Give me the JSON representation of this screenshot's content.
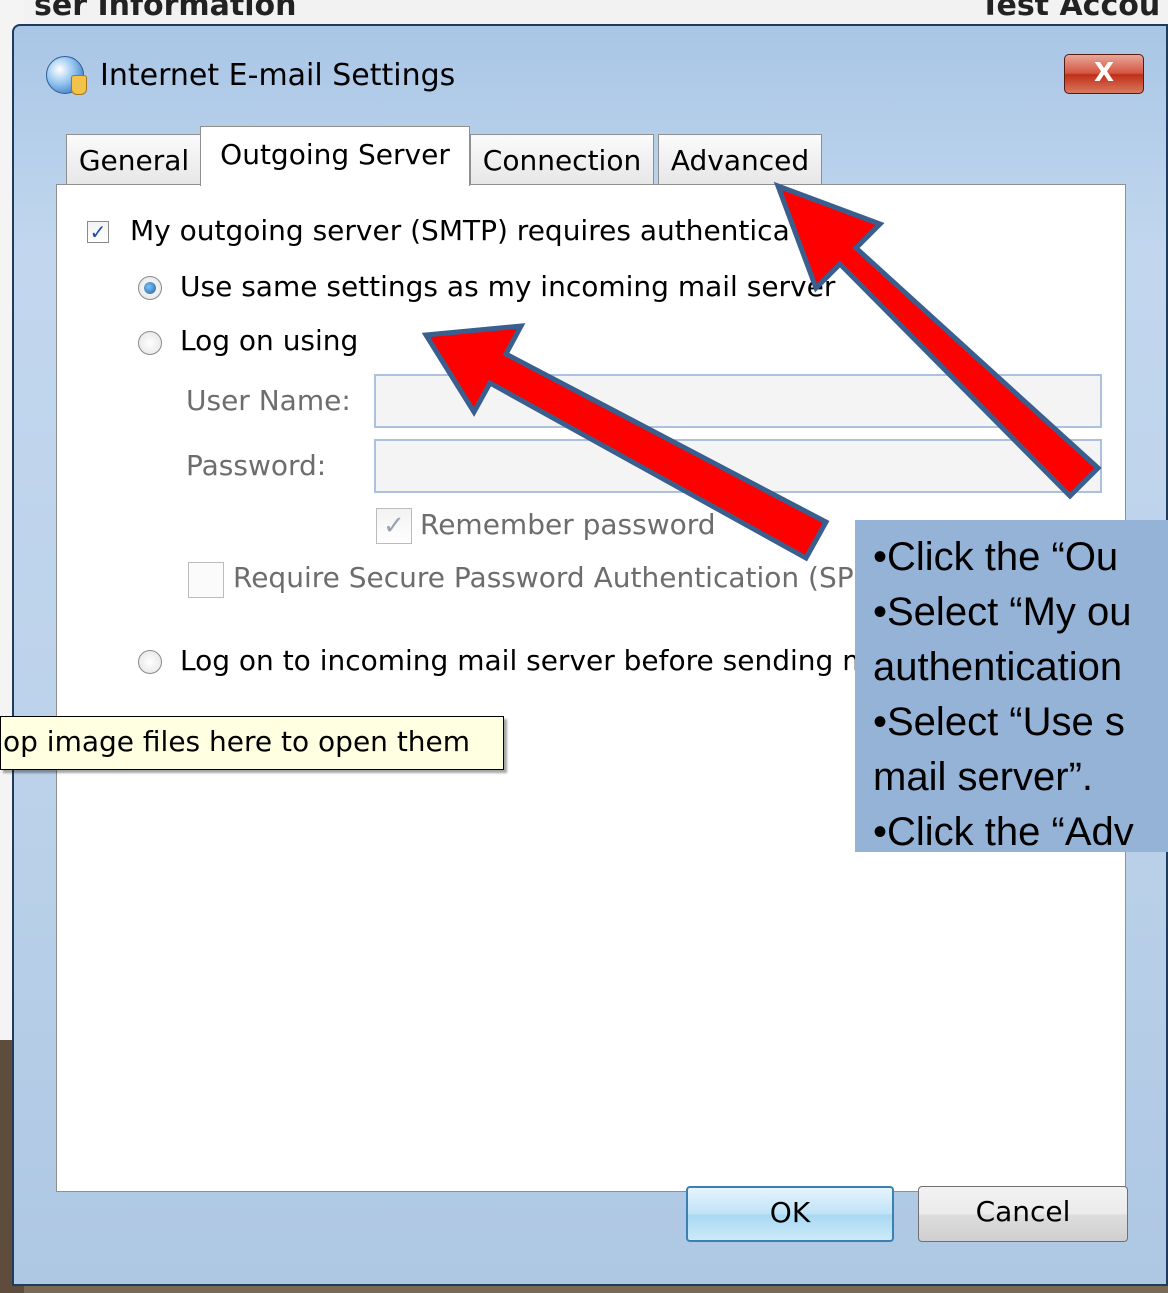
{
  "background": {
    "title_left": "ser Information",
    "title_right": "Test Accou"
  },
  "window": {
    "title": "Internet E-mail Settings",
    "close_label": "X"
  },
  "tabs": [
    {
      "label": "General",
      "active": false
    },
    {
      "label": "Outgoing Server",
      "active": true
    },
    {
      "label": "Connection",
      "active": false
    },
    {
      "label": "Advanced",
      "active": false
    }
  ],
  "outgoing": {
    "smtp_auth_label": "My outgoing server (SMTP) requires authentica",
    "smtp_auth_checked": true,
    "use_same_label": "Use same settings as my incoming mail server",
    "use_same_selected": true,
    "log_on_using_label": "Log on using",
    "log_on_using_selected": false,
    "user_name_label": "User Name:",
    "user_name_value": "",
    "password_label": "Password:",
    "password_value": "",
    "remember_password_label": "Remember password",
    "remember_password_checked": true,
    "spa_label": "Require Secure Password Authentication (SP",
    "spa_checked": false,
    "log_on_incoming_label": "Log on to incoming mail server before sending ma",
    "log_on_incoming_selected": false
  },
  "tooltip": "op image files here to open them",
  "buttons": {
    "ok": "OK",
    "cancel": "Cancel"
  },
  "annotation": {
    "lines": [
      "•Click the “Ou",
      "•Select “My ou",
      "authentication",
      "•Select “Use s",
      "mail server”.",
      "•Click the “Adv"
    ],
    "arrow_color": "#ff0000",
    "arrow_outline": "#3a5f8f"
  },
  "colors": {
    "frame": "#bcd2ea",
    "note_bg": "#95b3d7",
    "tooltip_bg": "#ffffe1"
  }
}
